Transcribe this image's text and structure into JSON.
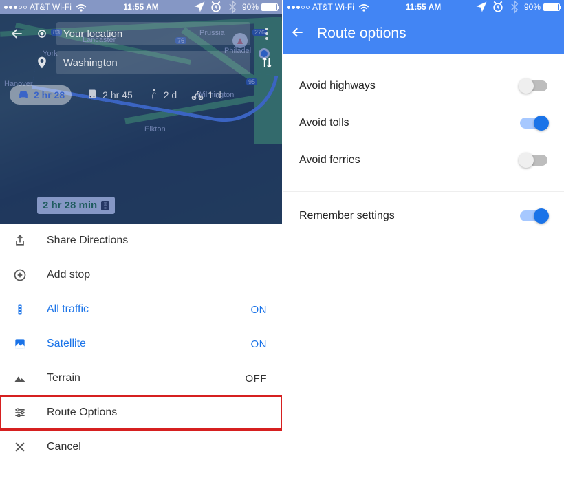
{
  "status": {
    "carrier": "AT&T Wi-Fi",
    "time": "11:55 AM",
    "battery": "90%"
  },
  "left": {
    "from": "Your location",
    "to": "Washington",
    "modes": {
      "car": "2 hr 28",
      "transit": "2 hr 45",
      "walk": "2 d",
      "bike": "1 d"
    },
    "map": {
      "bubble": "2 hr 28 min",
      "places": [
        "Lancaster",
        "York",
        "Hanover",
        "Prussia",
        "Philadel",
        "Wilmington",
        "Elkton"
      ],
      "shields": [
        "83",
        "76",
        "276",
        "95"
      ]
    },
    "menu": {
      "share": "Share Directions",
      "add_stop": "Add stop",
      "traffic": "All traffic",
      "traffic_state": "ON",
      "satellite": "Satellite",
      "satellite_state": "ON",
      "terrain": "Terrain",
      "terrain_state": "OFF",
      "route_options": "Route Options",
      "cancel": "Cancel"
    }
  },
  "right": {
    "title": "Route options",
    "highways": "Avoid highways",
    "tolls": "Avoid tolls",
    "ferries": "Avoid ferries",
    "remember": "Remember settings"
  }
}
